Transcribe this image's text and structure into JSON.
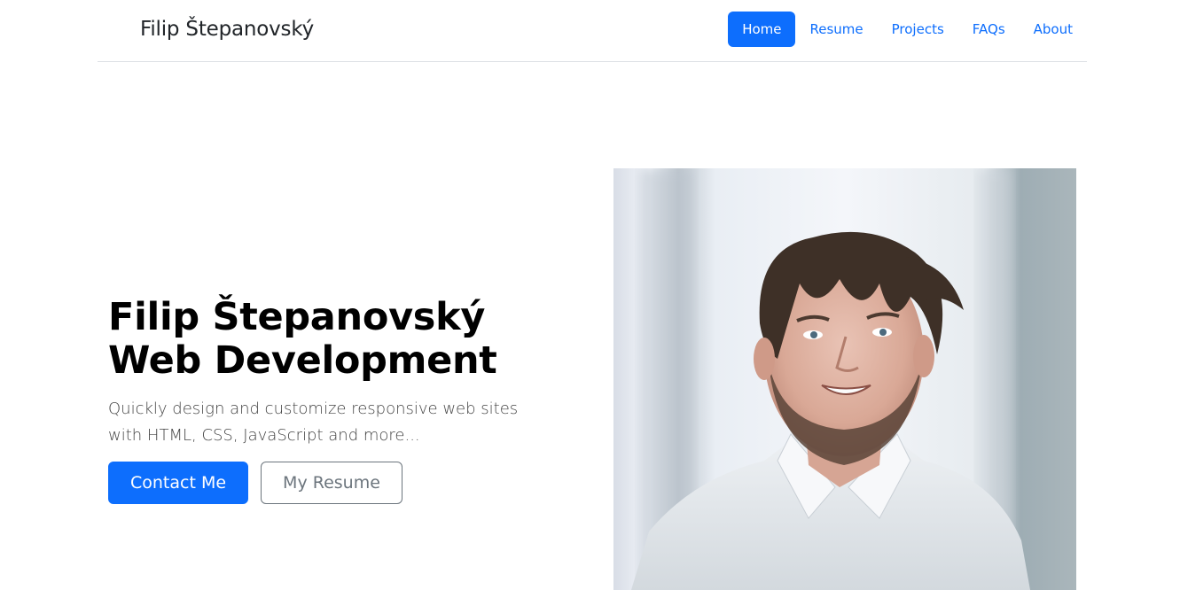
{
  "brand": "Filip Štepanovský",
  "nav": {
    "items": [
      {
        "label": "Home",
        "active": true
      },
      {
        "label": "Resume",
        "active": false
      },
      {
        "label": "Projects",
        "active": false
      },
      {
        "label": "FAQs",
        "active": false
      },
      {
        "label": "About",
        "active": false
      }
    ]
  },
  "hero": {
    "title": "Filip Štepanovský Web Development",
    "lead": "Quickly design and customize responsive web sites with HTML, CSS, JavaScript and more...",
    "primary_button": "Contact Me",
    "secondary_button": "My Resume"
  },
  "colors": {
    "accent": "#0d6efd",
    "muted": "#6c757d"
  }
}
